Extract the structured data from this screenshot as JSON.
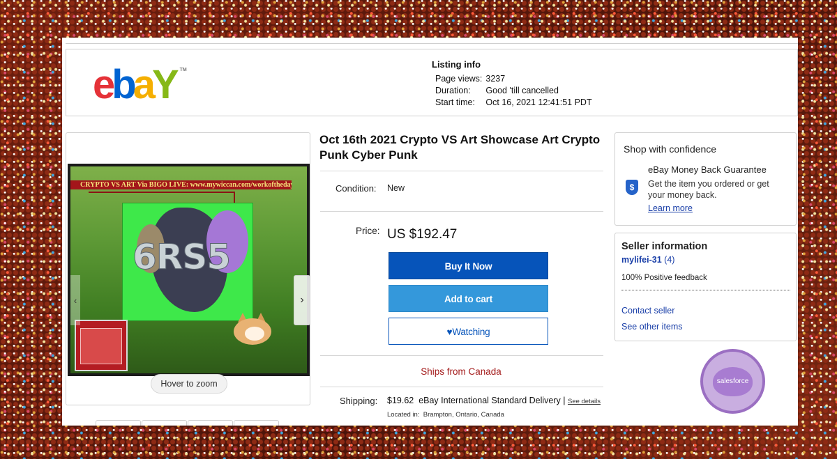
{
  "header": {
    "logo_letters": [
      "e",
      "b",
      "a",
      "Y"
    ],
    "logo_tm": "TM",
    "listing_info_title": "Listing info",
    "rows": [
      {
        "label": "Page views:",
        "value": "3237"
      },
      {
        "label": "Duration:",
        "value": "Good 'till cancelled"
      },
      {
        "label": "Start time:",
        "value": "Oct 16, 2021 12:41:51 PDT"
      }
    ]
  },
  "gallery": {
    "banner_text": "CRYPTO VS ART Via BIGO LIVE: www.mywiccan.com/workoftheday",
    "art_text": "6RS5",
    "hover_zoom": "Hover to zoom",
    "next_icon": "chevron-right-icon",
    "prev_icon": "chevron-left-icon"
  },
  "item": {
    "title": "Oct 16th 2021 Crypto VS Art Showcase Art Crypto Punk Cyber Punk",
    "condition_label": "Condition:",
    "condition_value": "New",
    "price_label": "Price:",
    "price_value": "US $192.47",
    "buy_now": "Buy It Now",
    "add_to_cart": "Add to cart",
    "watching": "Watching",
    "watching_icon": "heart-icon",
    "ships_from": "Ships from Canada",
    "shipping_label": "Shipping:",
    "shipping_price": "$19.62",
    "shipping_method": "eBay International Standard Delivery |",
    "see_details": "See details",
    "located_label": "Located in:",
    "located_value": "Brampton, Ontario, Canada"
  },
  "confidence": {
    "title": "Shop with confidence",
    "guarantee_title": "eBay Money Back Guarantee",
    "guarantee_text": "Get the item you ordered or get your money back.",
    "learn_more": "Learn more",
    "icon": "shield-dollar-icon"
  },
  "seller": {
    "title": "Seller information",
    "name": "mylifei-31",
    "score": "(4)",
    "feedback": "100% Positive feedback",
    "contact": "Contact seller",
    "other_items": "See other items"
  },
  "badge": {
    "text": "salesforce"
  },
  "colors": {
    "buy_now_bg": "#0654ba",
    "add_to_cart_bg": "#3498db",
    "ships_text": "#a31a1a",
    "link": "#1a3fa8",
    "badge_ring": "#9b6fc2"
  }
}
